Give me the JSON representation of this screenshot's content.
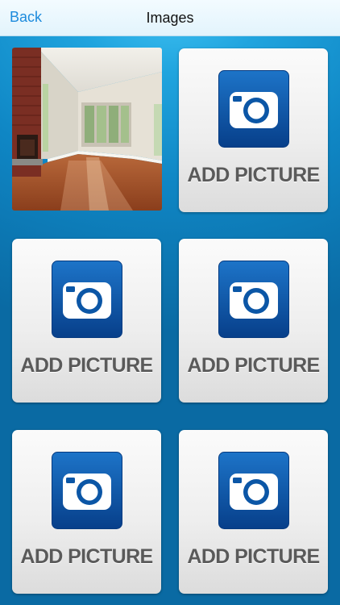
{
  "navbar": {
    "back_label": "Back",
    "title": "Images"
  },
  "tiles": [
    {
      "kind": "photo",
      "icon": "room-photo"
    },
    {
      "kind": "add",
      "label": "ADD PICTURE",
      "icon": "camera-icon"
    },
    {
      "kind": "add",
      "label": "ADD PICTURE",
      "icon": "camera-icon"
    },
    {
      "kind": "add",
      "label": "ADD PICTURE",
      "icon": "camera-icon"
    },
    {
      "kind": "add",
      "label": "ADD PICTURE",
      "icon": "camera-icon"
    },
    {
      "kind": "add",
      "label": "ADD PICTURE",
      "icon": "camera-icon"
    }
  ],
  "colors": {
    "accent": "#1d8bdd",
    "background_top": "#42c4f4",
    "background_bottom": "#0a6aa3",
    "camera_blue": "#0a4f9e"
  }
}
